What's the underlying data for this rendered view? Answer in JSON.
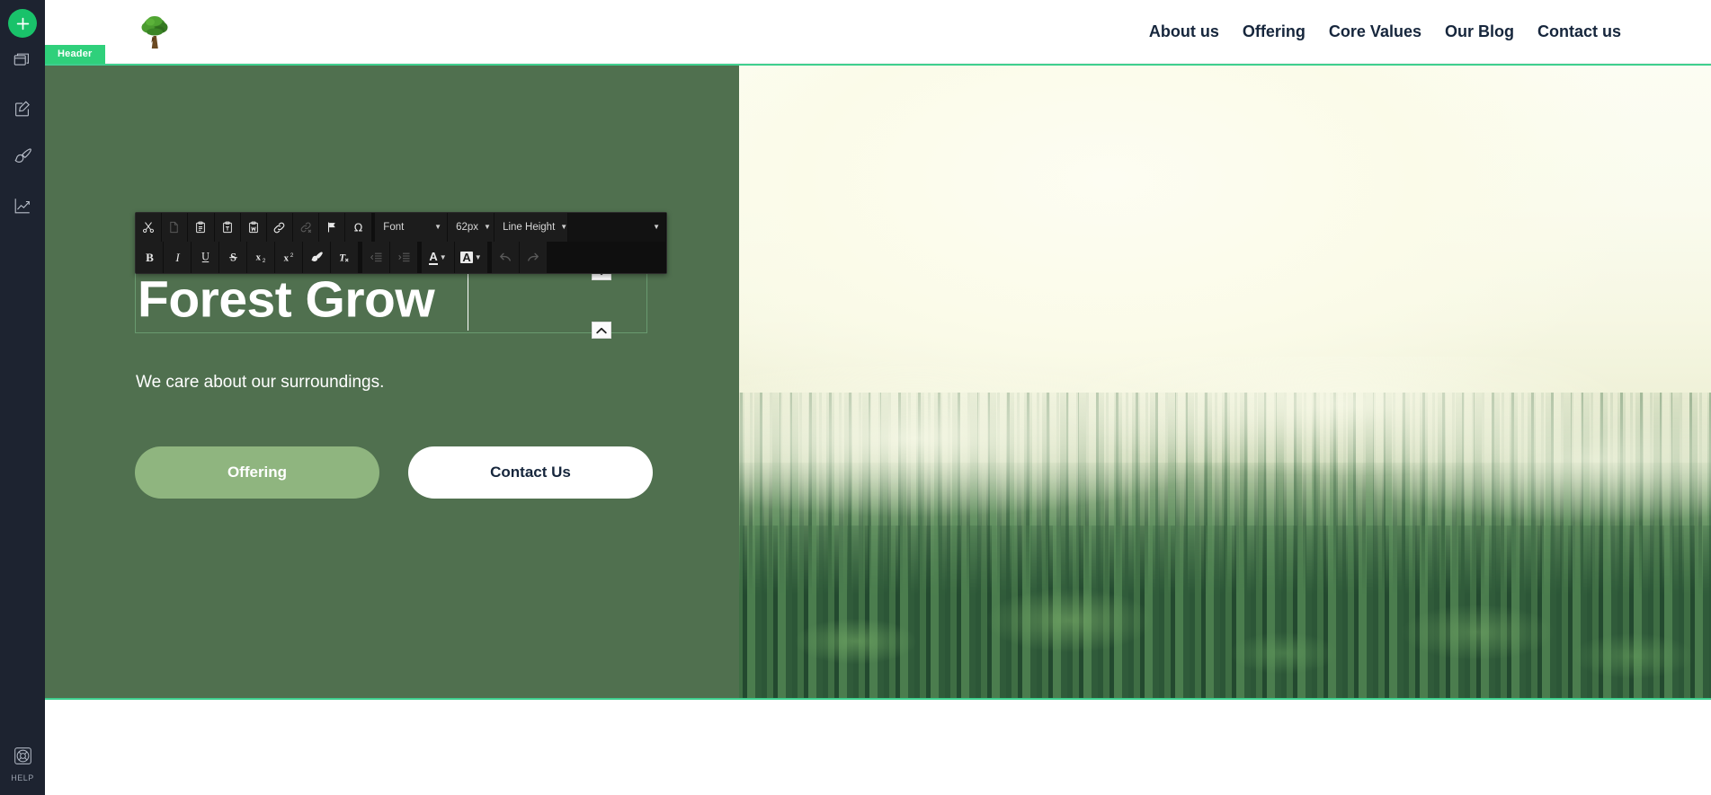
{
  "rail": {
    "add_button": "add-new",
    "items": [
      {
        "name": "pages",
        "icon": "pages-icon"
      },
      {
        "name": "edit",
        "icon": "edit-square-icon"
      },
      {
        "name": "design",
        "icon": "paintbrush-icon"
      },
      {
        "name": "analytics",
        "icon": "analytics-chart-icon"
      }
    ],
    "help_label": "HELP"
  },
  "section_tag": {
    "label": "Header"
  },
  "site_header": {
    "logo_alt": "tree-logo",
    "nav": [
      {
        "label": "About us"
      },
      {
        "label": "Offering"
      },
      {
        "label": "Core Values"
      },
      {
        "label": "Our Blog"
      },
      {
        "label": "Contact us"
      }
    ]
  },
  "hero": {
    "heading": "Forest Grow",
    "subheading": "We care about our surroundings.",
    "primary_button": "Offering",
    "secondary_button": "Contact Us",
    "image_alt": "misty-evergreen-forest-photo"
  },
  "editor_toolbar": {
    "row1": [
      {
        "name": "cut",
        "icon": "scissors-icon",
        "disabled": false
      },
      {
        "name": "copy",
        "icon": "copy-icon",
        "disabled": true
      },
      {
        "name": "paste",
        "icon": "paste-icon",
        "disabled": false
      },
      {
        "name": "paste-as-text",
        "icon": "paste-text-icon",
        "disabled": false
      },
      {
        "name": "paste-from-word",
        "icon": "paste-word-icon",
        "disabled": false
      },
      {
        "name": "insert-link",
        "icon": "link-icon",
        "disabled": false
      },
      {
        "name": "remove-link",
        "icon": "unlink-icon",
        "disabled": true
      },
      {
        "name": "anchor",
        "icon": "flag-icon",
        "disabled": false
      },
      {
        "name": "special-character",
        "icon": "omega-icon",
        "disabled": false
      }
    ],
    "font_select": {
      "label": "Font",
      "value": "Font"
    },
    "size_select": {
      "label": "62px",
      "value": "62px"
    },
    "line_height_select": {
      "label": "Line Height",
      "value": "Line Height"
    },
    "format_select": {
      "label": "",
      "value": ""
    },
    "row2": [
      {
        "name": "bold",
        "icon": "bold-icon",
        "disabled": false
      },
      {
        "name": "italic",
        "icon": "italic-icon",
        "disabled": false
      },
      {
        "name": "underline",
        "icon": "underline-icon",
        "disabled": false
      },
      {
        "name": "strikethrough",
        "icon": "strikethrough-icon",
        "disabled": false
      },
      {
        "name": "subscript",
        "icon": "subscript-icon",
        "disabled": false
      },
      {
        "name": "superscript",
        "icon": "superscript-icon",
        "disabled": false
      },
      {
        "name": "format-painter",
        "icon": "paintbrush-icon",
        "disabled": false
      },
      {
        "name": "remove-format",
        "icon": "remove-format-icon",
        "disabled": false
      },
      {
        "name": "decrease-indent",
        "icon": "outdent-icon",
        "disabled": true
      },
      {
        "name": "increase-indent",
        "icon": "indent-icon",
        "disabled": true
      },
      {
        "name": "text-color",
        "icon": "text-color-icon",
        "disabled": false
      },
      {
        "name": "background-color",
        "icon": "background-color-icon",
        "disabled": false
      },
      {
        "name": "undo",
        "icon": "undo-arrow-icon",
        "disabled": false
      },
      {
        "name": "redo",
        "icon": "redo-arrow-icon",
        "disabled": false
      }
    ]
  },
  "element_controls": {
    "move_down": "chevron-down-icon",
    "move_up": "chevron-up-icon"
  },
  "colors": {
    "rail_bg": "#1d2330",
    "accent_green": "#19c26a",
    "tag_green": "#2fd07b",
    "section_border": "#3ecf8e",
    "hero_panel": "#50704f",
    "primary_button": "#8fb57f",
    "nav_text": "#16263c",
    "toolbar_bg": "#0f0f0f"
  }
}
